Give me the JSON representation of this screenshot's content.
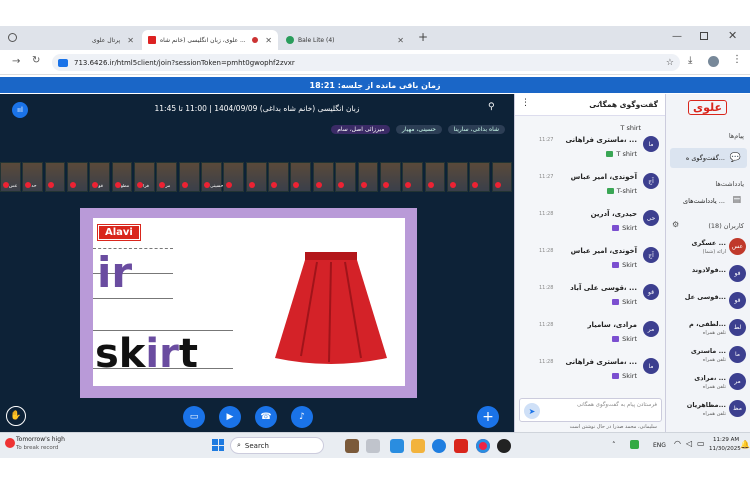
{
  "browser": {
    "tabs": [
      {
        "label": "پرتال علوی"
      },
      {
        "label": "علوی، زبان انگلیسی (خانم شاه ..."
      },
      {
        "label": "Bale Lite (4)"
      }
    ],
    "new_tab": "+",
    "url": "713.6426.ir/html5client/join?sessionToken=pmht0gwophf2zvxr"
  },
  "banner": {
    "text": "زمان باقی مانده از جلسه: 18:21"
  },
  "meeting": {
    "title": "زبان انگلیسی (خانم شاه بداغی) 1404/09/09 | 11:00 تا 11:45",
    "presenters": [
      "شاه بداغی، سارینا",
      "حسینی، مهیار",
      "میرزائی اصل، سام"
    ],
    "thumbs": [
      "عس",
      "حد",
      "",
      "",
      "قو",
      "مطو",
      "فرا",
      "مر",
      "",
      "حسینی",
      "",
      "",
      "",
      "",
      "",
      "",
      "",
      "",
      "",
      "",
      "",
      "",
      ""
    ],
    "slide": {
      "logo": "Alavi",
      "phonics": "ir",
      "word_part1": "sk",
      "word_part2": "ir",
      "word_part3": "t"
    }
  },
  "chat": {
    "title": "گفت‌وگوی همگانی",
    "top_text": "T shirt",
    "messages": [
      {
        "initials": "ما",
        "name": "ماستری فراهانی، ...",
        "time": "11:27",
        "text": "T shirt"
      },
      {
        "initials": "آج",
        "name": "آخوندی، امیر عباس",
        "time": "11:27",
        "text": "T-shirt"
      },
      {
        "initials": "حی",
        "name": "حیدری، آدرین",
        "time": "11:28",
        "text": "Skirt"
      },
      {
        "initials": "آج",
        "name": "آخوندی، امیر عباس",
        "time": "11:28",
        "text": "Skirt"
      },
      {
        "initials": "قو",
        "name": "قوسی علی آباد، ...",
        "time": "11:28",
        "text": "Skirt"
      },
      {
        "initials": "مر",
        "name": "مرادی، سامیار",
        "time": "11:28",
        "text": "Skirt"
      },
      {
        "initials": "ما",
        "name": "ماستری فراهانی، ...",
        "time": "11:28",
        "text": "Skirt"
      }
    ],
    "input_placeholder": "فرستادن پیام به گفت‌وگوی همگانی",
    "typing": "سلیمانی، محمد صدرا در حال نوشتن است"
  },
  "sidebar": {
    "brand": "علوی",
    "messages_heading": "پیام‌ها",
    "public_chat": "گفت‌وگوی ه...",
    "notes_heading": "یادداشت‌ها",
    "shared_notes": "یادداشت‌های ...",
    "users_heading": "کاربران (18)",
    "users": [
      {
        "initials": "عس",
        "name": "عسگری ...",
        "status": "(شما) ارائه",
        "color": "#c0392b"
      },
      {
        "initials": "فو",
        "name": "فولادوند...",
        "status": "",
        "color": "#3c3f8f"
      },
      {
        "initials": "قو",
        "name": "قوسی عل...",
        "status": "",
        "color": "#3c3f8f"
      },
      {
        "initials": "لط",
        "name": "لطفی، م...",
        "status": "تلفن همراه",
        "color": "#3c3f8f"
      },
      {
        "initials": "ما",
        "name": "ماستری ...",
        "status": "تلفن همراه",
        "color": "#3c3f8f"
      },
      {
        "initials": "مر",
        "name": "مرادی، ...",
        "status": "تلفن همراه",
        "color": "#3c3f8f"
      },
      {
        "initials": "مظ",
        "name": "مظاهریان...",
        "status": "تلفن همراه",
        "color": "#3c3f8f"
      }
    ]
  },
  "taskbar": {
    "weather_title": "Tomorrow's high",
    "weather_sub": "To break record",
    "search": "Search",
    "lang": "ENG",
    "time": "11:29 AM",
    "date": "11/30/2025"
  }
}
